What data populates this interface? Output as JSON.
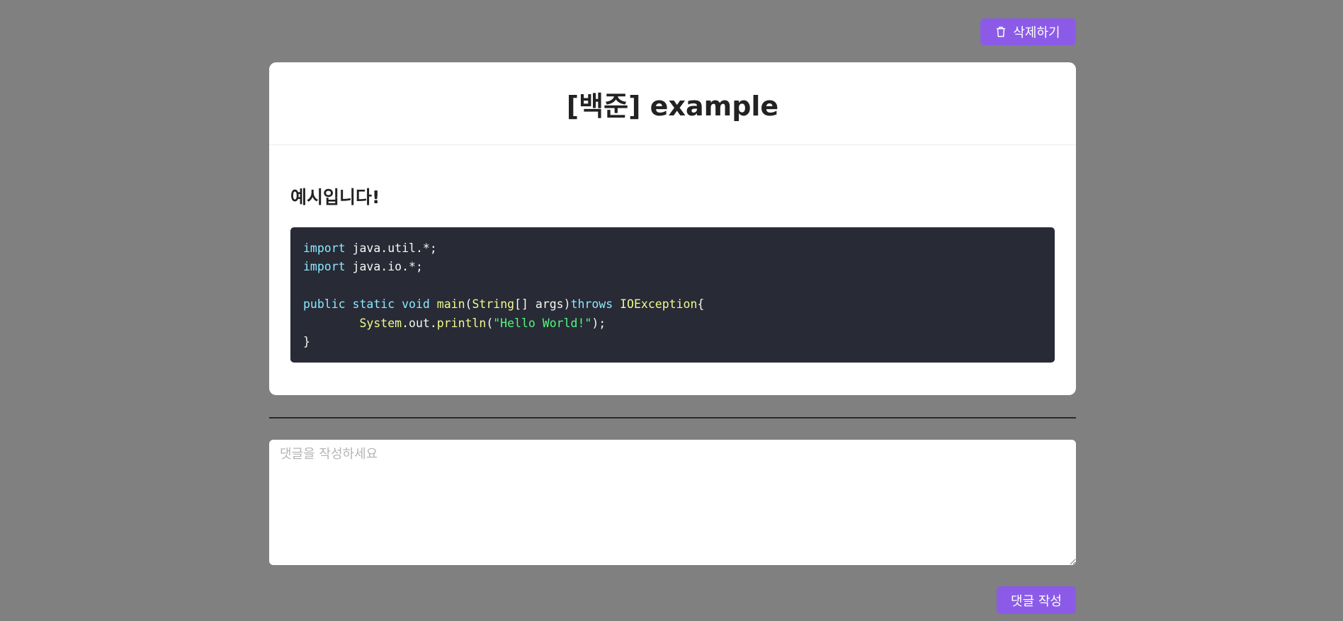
{
  "toolbar": {
    "delete_label": "삭제하기",
    "delete_icon": "trash-icon"
  },
  "post": {
    "title": "[백준] example",
    "subtitle": "예시입니다!",
    "code": {
      "language": "java",
      "lines": [
        "import java.util.*;",
        "import java.io.*;",
        "",
        "public static void main(String[] args)throws IOException{",
        "        System.out.println(\"Hello World!\");",
        "}"
      ]
    }
  },
  "comment": {
    "placeholder": "댓글을 작성하세요",
    "value": "",
    "submit_label": "댓글 작성"
  },
  "colors": {
    "background": "#808080",
    "accent": "#8b5be8",
    "card": "#ffffff",
    "code_bg": "#282a36"
  }
}
